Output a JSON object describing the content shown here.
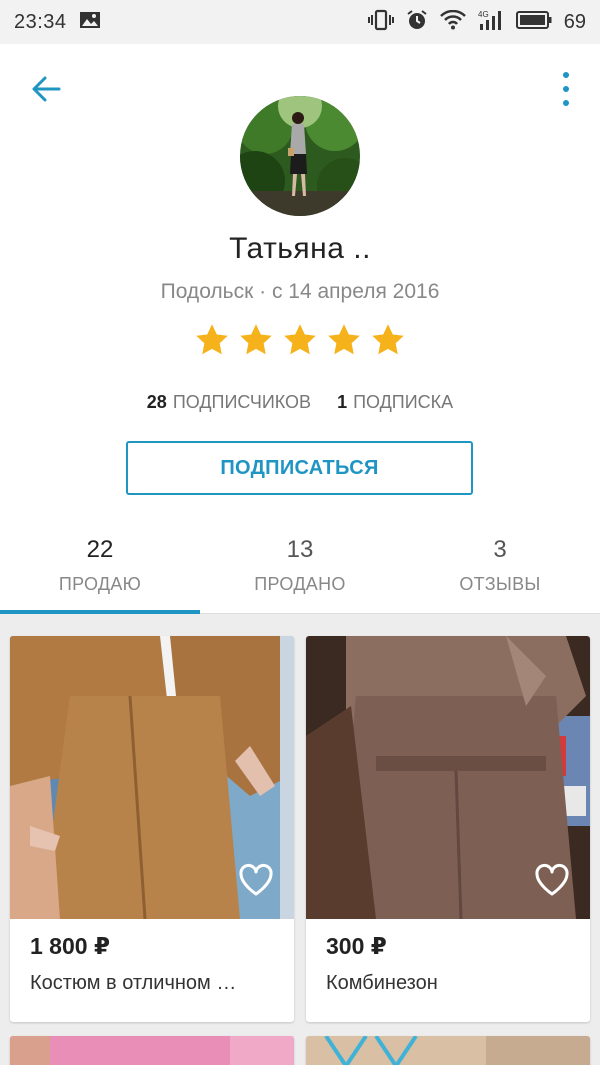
{
  "status_bar": {
    "time": "23:34",
    "battery": "69",
    "network": "4G"
  },
  "profile": {
    "name": "Татьяна ..",
    "location": "Подольск · с 14 апреля 2016",
    "rating": 5,
    "followers_count": "28",
    "followers_label": "ПОДПИСЧИКОВ",
    "following_count": "1",
    "following_label": "ПОДПИСКА",
    "subscribe_label": "ПОДПИСАТЬСЯ"
  },
  "tabs": [
    {
      "count": "22",
      "label": "ПРОДАЮ",
      "active": true
    },
    {
      "count": "13",
      "label": "ПРОДАНО",
      "active": false
    },
    {
      "count": "3",
      "label": "ОТЗЫВЫ",
      "active": false
    }
  ],
  "listings": [
    {
      "price": "1 800 ₽",
      "title": "Костюм в отличном …"
    },
    {
      "price": "300 ₽",
      "title": "Комбинезон"
    }
  ],
  "colors": {
    "accent": "#1e95c3",
    "star": "#f6b21b"
  }
}
